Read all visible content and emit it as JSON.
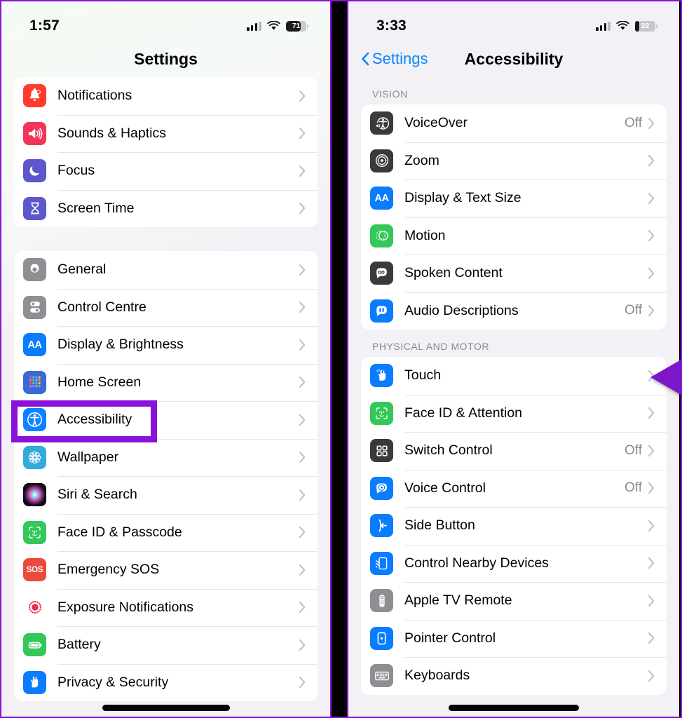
{
  "left_phone": {
    "status_bar": {
      "time": "1:57",
      "cellular_icon": "cellular-bars-icon",
      "wifi_icon": "wifi-icon",
      "battery_percent": "71",
      "battery_level": 71
    },
    "nav": {
      "title": "Settings"
    },
    "groups": [
      {
        "items": [
          {
            "label": "Notifications",
            "icon": "notifications-icon",
            "color": "#FF3B30",
            "value": ""
          },
          {
            "label": "Sounds & Haptics",
            "icon": "sounds-haptics-icon",
            "color": "#F1355A",
            "value": ""
          },
          {
            "label": "Focus",
            "icon": "focus-icon",
            "color": "#5C57CC",
            "value": ""
          },
          {
            "label": "Screen Time",
            "icon": "screen-time-icon",
            "color": "#5C57CC",
            "value": ""
          }
        ]
      },
      {
        "items": [
          {
            "label": "General",
            "icon": "general-gear-icon",
            "color": "#8E8E93",
            "value": ""
          },
          {
            "label": "Control Centre",
            "icon": "control-centre-icon",
            "color": "#8E8E93",
            "value": ""
          },
          {
            "label": "Display & Brightness",
            "icon": "display-brightness-icon",
            "color": "#0A7CFF",
            "value": ""
          },
          {
            "label": "Home Screen",
            "icon": "home-screen-icon",
            "color": "#3A68D8",
            "value": ""
          },
          {
            "label": "Accessibility",
            "icon": "accessibility-icon",
            "color": "#0A84FF",
            "value": ""
          },
          {
            "label": "Wallpaper",
            "icon": "wallpaper-icon",
            "color": "#34AADC",
            "value": ""
          },
          {
            "label": "Siri & Search",
            "icon": "siri-search-icon",
            "color": "#1C1C1E",
            "value": ""
          },
          {
            "label": "Face ID & Passcode",
            "icon": "face-id-icon",
            "color": "#34C759",
            "value": ""
          },
          {
            "label": "Emergency SOS",
            "icon": "emergency-sos-icon",
            "color": "#EB4B3B",
            "value": ""
          },
          {
            "label": "Exposure Notifications",
            "icon": "exposure-notifications-icon",
            "color": "#FFFFFF",
            "value": ""
          },
          {
            "label": "Battery",
            "icon": "battery-icon",
            "color": "#34C759",
            "value": ""
          },
          {
            "label": "Privacy & Security",
            "icon": "privacy-security-icon",
            "color": "#0A7CFF",
            "value": ""
          }
        ]
      }
    ]
  },
  "right_phone": {
    "status_bar": {
      "time": "3:33",
      "cellular_icon": "cellular-bars-icon",
      "wifi_icon": "wifi-icon",
      "battery_percent": "22",
      "battery_level": 22
    },
    "nav": {
      "back_label": "Settings",
      "title": "Accessibility"
    },
    "groups": [
      {
        "header": "VISION",
        "items": [
          {
            "label": "VoiceOver",
            "icon": "voiceover-icon",
            "color": "#3A3A3C",
            "value": "Off"
          },
          {
            "label": "Zoom",
            "icon": "zoom-icon",
            "color": "#3A3A3C",
            "value": ""
          },
          {
            "label": "Display & Text Size",
            "icon": "display-text-size-icon",
            "color": "#0A7CFF",
            "value": ""
          },
          {
            "label": "Motion",
            "icon": "motion-icon",
            "color": "#34C759",
            "value": ""
          },
          {
            "label": "Spoken Content",
            "icon": "spoken-content-icon",
            "color": "#3A3A3C",
            "value": ""
          },
          {
            "label": "Audio Descriptions",
            "icon": "audio-descriptions-icon",
            "color": "#0A7CFF",
            "value": "Off"
          }
        ]
      },
      {
        "header": "PHYSICAL AND MOTOR",
        "items": [
          {
            "label": "Touch",
            "icon": "touch-icon",
            "color": "#0A7CFF",
            "value": ""
          },
          {
            "label": "Face ID & Attention",
            "icon": "face-id-attention-icon",
            "color": "#34C759",
            "value": ""
          },
          {
            "label": "Switch Control",
            "icon": "switch-control-icon",
            "color": "#3A3A3C",
            "value": "Off"
          },
          {
            "label": "Voice Control",
            "icon": "voice-control-icon",
            "color": "#0A7CFF",
            "value": "Off"
          },
          {
            "label": "Side Button",
            "icon": "side-button-icon",
            "color": "#0A7CFF",
            "value": ""
          },
          {
            "label": "Control Nearby Devices",
            "icon": "control-nearby-devices-icon",
            "color": "#0A7CFF",
            "value": ""
          },
          {
            "label": "Apple TV Remote",
            "icon": "apple-tv-remote-icon",
            "color": "#8E8E93",
            "value": ""
          },
          {
            "label": "Pointer Control",
            "icon": "pointer-control-icon",
            "color": "#0A7CFF",
            "value": ""
          },
          {
            "label": "Keyboards",
            "icon": "keyboards-icon",
            "color": "#8E8E93",
            "value": ""
          }
        ]
      }
    ]
  },
  "annotations": {
    "highlight_color": "#8A12D8",
    "arrow_color": "#7B19C9",
    "highlight_target": "Accessibility",
    "arrow_target": "Touch"
  }
}
